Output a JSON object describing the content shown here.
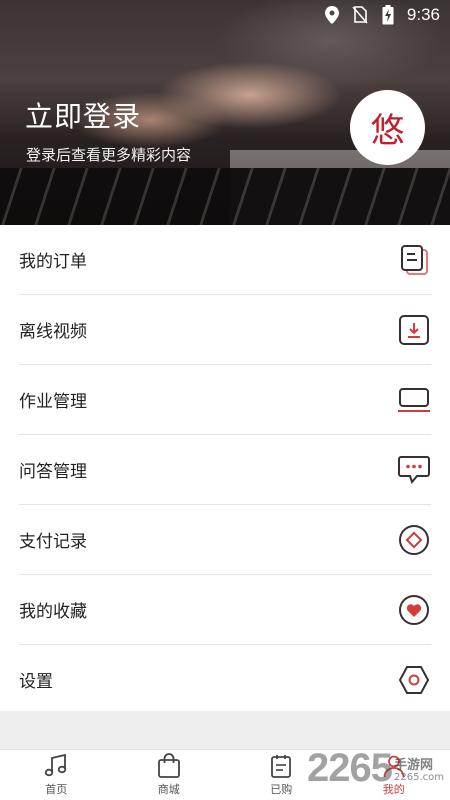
{
  "status_bar": {
    "time": "9:36",
    "icons": [
      "location-icon",
      "no-sim-icon",
      "battery-charging-icon"
    ]
  },
  "header": {
    "title": "立即登录",
    "subtitle": "登录后查看更多精彩内容",
    "avatar_char": "悠"
  },
  "menu": {
    "items": [
      {
        "label": "我的订单",
        "icon": "orders-icon"
      },
      {
        "label": "离线视频",
        "icon": "download-icon"
      },
      {
        "label": "作业管理",
        "icon": "homework-icon"
      },
      {
        "label": "问答管理",
        "icon": "chat-bubble-icon"
      },
      {
        "label": "支付记录",
        "icon": "payment-icon"
      },
      {
        "label": "我的收藏",
        "icon": "heart-icon"
      },
      {
        "label": "设置",
        "icon": "settings-hexagon-icon"
      }
    ]
  },
  "tabbar": {
    "tabs": [
      {
        "label": "首页",
        "icon": "music-note-icon"
      },
      {
        "label": "商城",
        "icon": "shopping-bag-icon"
      },
      {
        "label": "已购",
        "icon": "clipboard-icon"
      },
      {
        "label": "我的",
        "icon": "user-icon",
        "active": true
      }
    ]
  },
  "watermark": {
    "number": "2265",
    "site_name": "手游网",
    "site_url": "2265.com"
  },
  "colors": {
    "accent": "#d43c3c",
    "avatar_text": "#c0202a",
    "icon_stroke": "#3a2f30"
  }
}
